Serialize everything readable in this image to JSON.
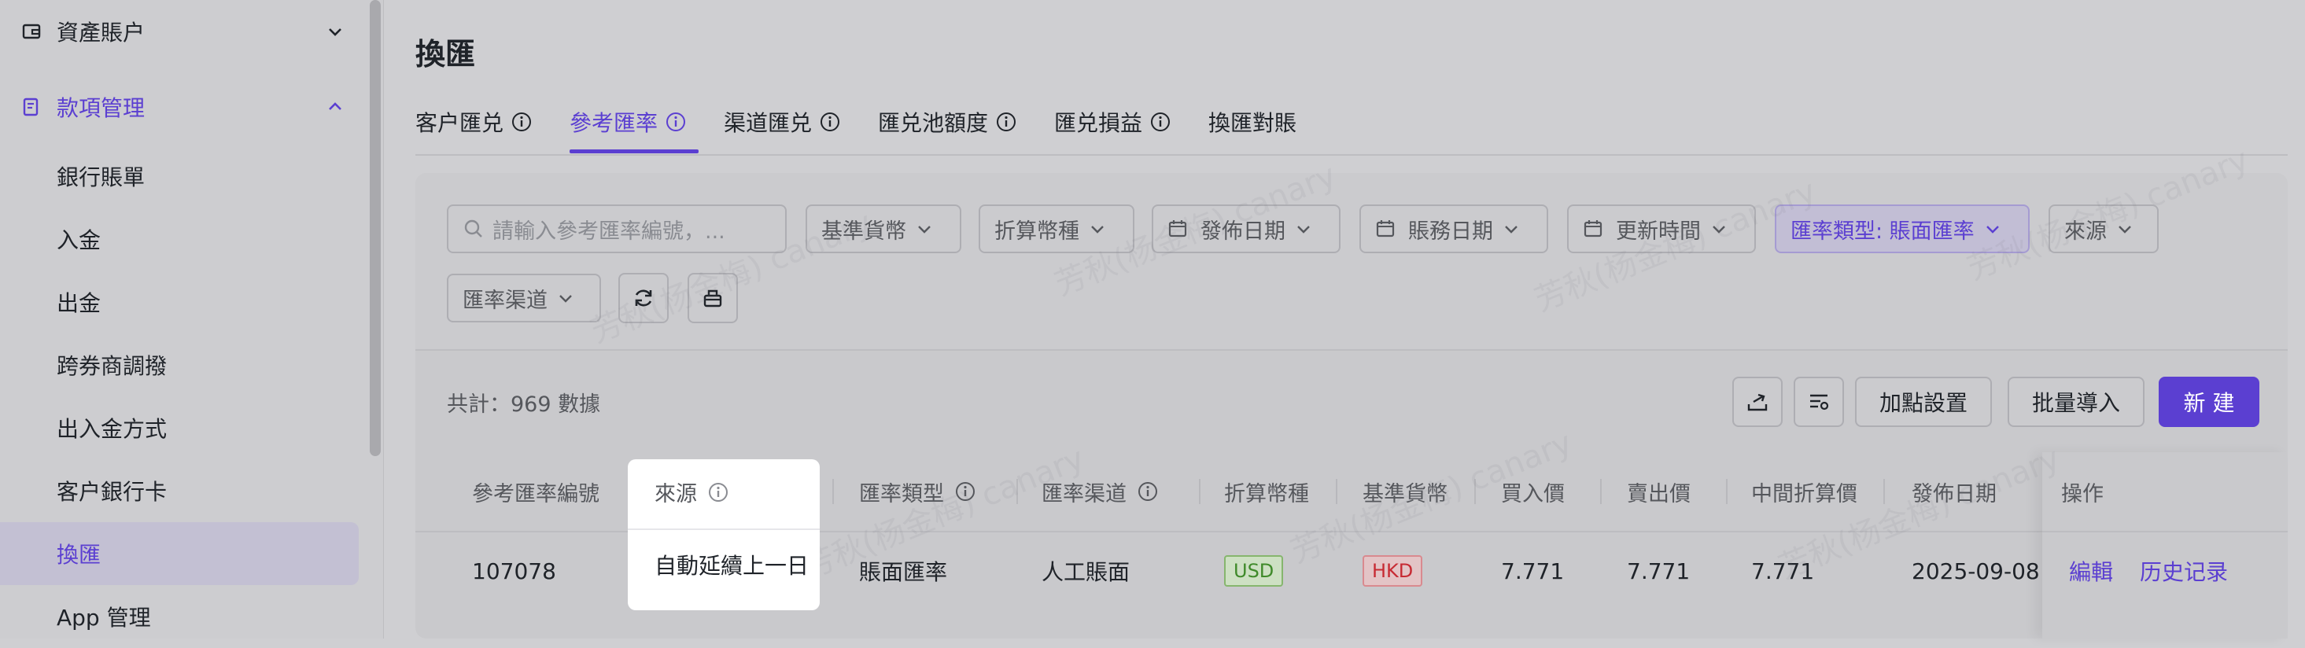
{
  "sidebar": {
    "top_items": [
      {
        "label": "資產賬户",
        "icon": "wallet-icon",
        "expanded": false
      },
      {
        "label": "款項管理",
        "icon": "document-icon",
        "expanded": true
      }
    ],
    "sub_items": [
      "銀行賬單",
      "入金",
      "出金",
      "跨券商調撥",
      "出入金方式",
      "客户銀行卡",
      "換匯",
      "App 管理"
    ],
    "active_sub": "換匯"
  },
  "page": {
    "title": "換匯"
  },
  "tabs": [
    {
      "label": "客户匯兑",
      "info": true
    },
    {
      "label": "參考匯率",
      "info": true,
      "active": true
    },
    {
      "label": "渠道匯兑",
      "info": true
    },
    {
      "label": "匯兑池額度",
      "info": true
    },
    {
      "label": "匯兑損益",
      "info": true
    },
    {
      "label": "換匯對賬",
      "info": false
    }
  ],
  "filters": {
    "search_placeholder": "請輸入參考匯率編號，...",
    "base_currency": "基準貨幣",
    "settle_currency": "折算幣種",
    "publish_date": "發佈日期",
    "account_date": "賬務日期",
    "update_time": "更新時間",
    "rate_type": "匯率類型: 賬面匯率",
    "source": "來源",
    "rate_channel": "匯率渠道"
  },
  "toolbar": {
    "count": "共計：969 數據",
    "markup_settings": "加點設置",
    "batch_import": "批量導入",
    "create": "新 建"
  },
  "table": {
    "columns": [
      "參考匯率編號",
      "來源",
      "匯率類型",
      "匯率渠道",
      "折算幣種",
      "基準貨幣",
      "買入價",
      "賣出價",
      "中間折算價",
      "發佈日期",
      "操作"
    ],
    "rows": [
      {
        "id": "107078",
        "source": "自動延續上一日",
        "rate_type": "賬面匯率",
        "channel": "人工賬面",
        "settle_currency": "USD",
        "base_currency": "HKD",
        "buy": "7.771",
        "sell": "7.771",
        "mid": "7.771",
        "publish_date": "2025-09-08",
        "actions": [
          "編輯",
          "历史记录"
        ]
      }
    ]
  },
  "colors": {
    "accent": "#5b3fd1",
    "usd_tag": "#3f8a2a",
    "hkd_tag": "#c72a33"
  },
  "watermark": "芳秋(杨金梅) canary"
}
